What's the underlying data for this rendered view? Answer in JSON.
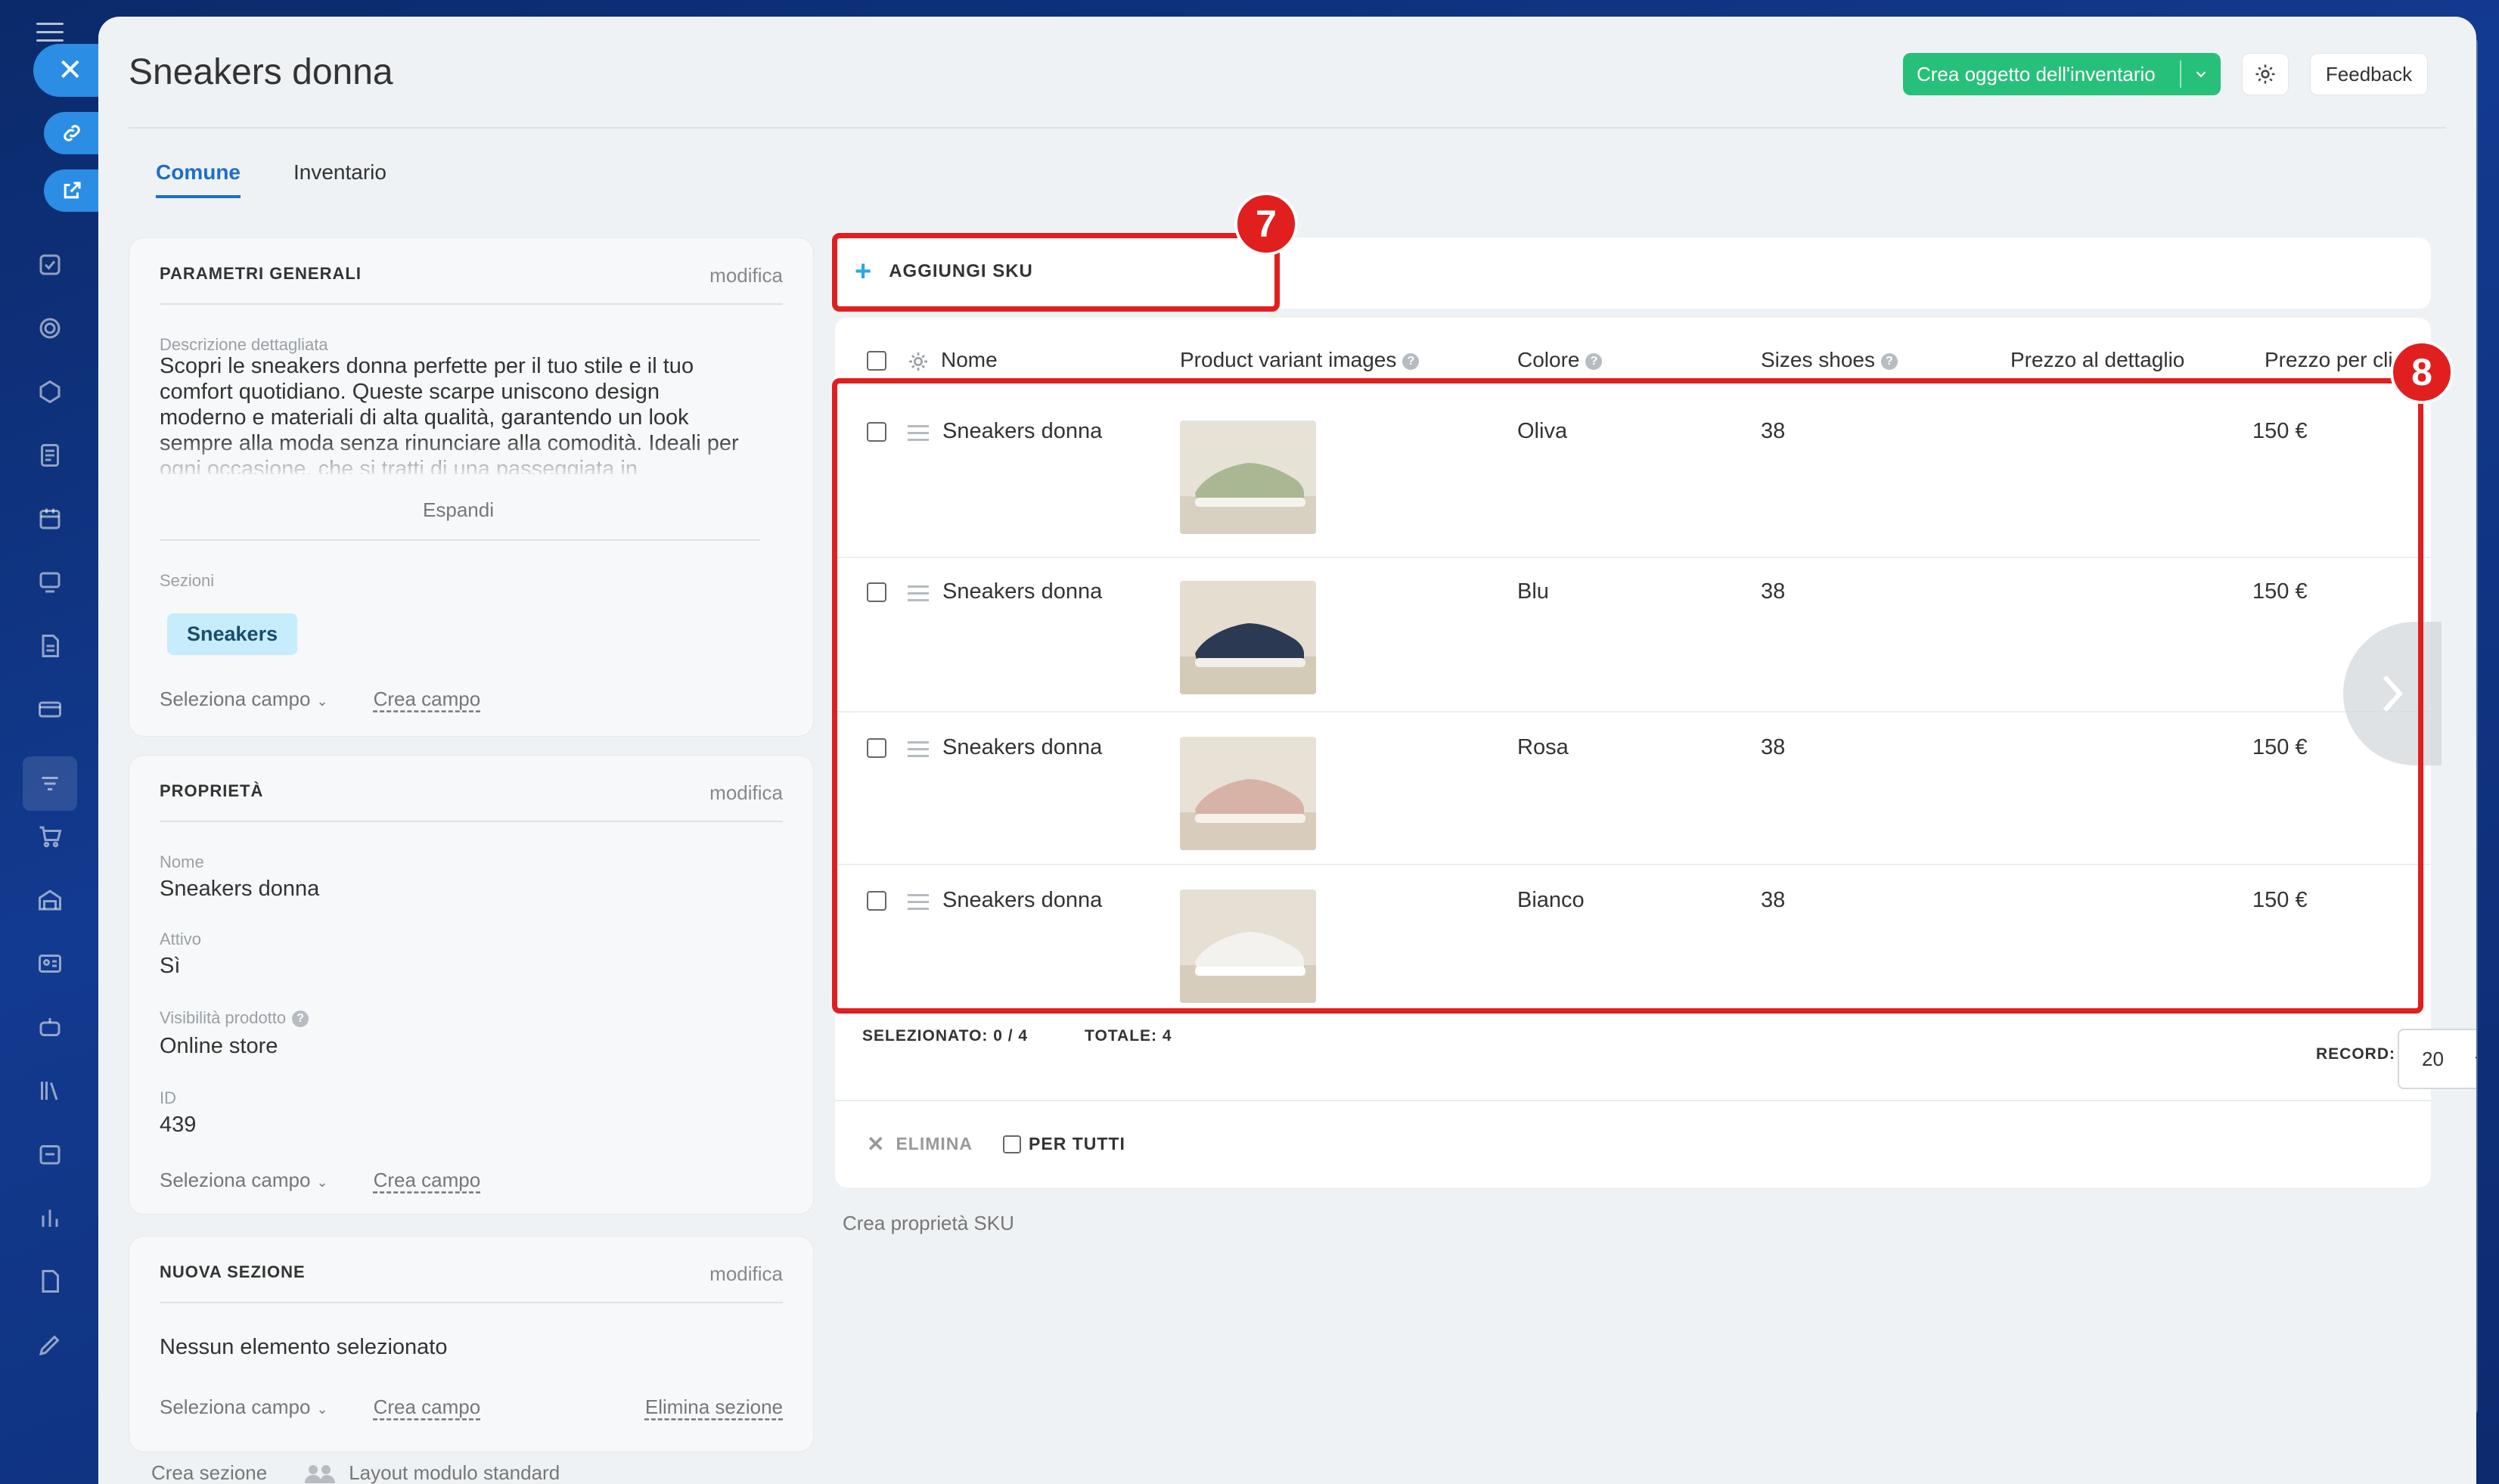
{
  "page": {
    "title": "Sneakers donna",
    "tabs": [
      "Comune",
      "Inventario"
    ],
    "create_button": "Crea oggetto dell'inventario",
    "feedback_button": "Feedback"
  },
  "general": {
    "header": "PARAMETRI GENERALI",
    "edit": "modifica",
    "desc_label": "Descrizione dettagliata",
    "description": "Scopri le sneakers donna perfette per il tuo stile e il tuo comfort quotidiano. Queste scarpe uniscono design moderno e materiali di alta qualità, garantendo un look sempre alla moda senza rinunciare alla comodità. Ideali per ogni occasione, che si tratti di una passeggiata in",
    "expand": "Espandi",
    "sections_label": "Sezioni",
    "section_tag": "Sneakers",
    "select_field": "Seleziona campo",
    "create_field": "Crea campo"
  },
  "properties": {
    "header": "PROPRIETÀ",
    "edit": "modifica",
    "name_label": "Nome",
    "name_value": "Sneakers donna",
    "active_label": "Attivo",
    "active_value": "Sì",
    "visibility_label": "Visibilità prodotto",
    "visibility_value": "Online store",
    "id_label": "ID",
    "id_value": "439",
    "select_field": "Seleziona campo",
    "create_field": "Crea campo"
  },
  "new_section": {
    "header": "NUOVA SEZIONE",
    "edit": "modifica",
    "empty": "Nessun elemento selezionato",
    "select_field": "Seleziona campo",
    "create_field": "Crea campo",
    "delete_section": "Elimina sezione"
  },
  "bottom": {
    "create_section": "Crea sezione",
    "layout": "Layout modulo standard"
  },
  "sku": {
    "add": "AGGIUNGI SKU",
    "columns": [
      "Nome",
      "Product variant images",
      "Colore",
      "Sizes shoes",
      "Prezzo al dettaglio",
      "Prezzo per clienti"
    ],
    "rows": [
      {
        "name": "Sneakers donna",
        "color": "Oliva",
        "size": "38",
        "price": "150 €"
      },
      {
        "name": "Sneakers donna",
        "color": "Blu",
        "size": "38",
        "price": "150 €"
      },
      {
        "name": "Sneakers donna",
        "color": "Rosa",
        "size": "38",
        "price": "150 €"
      },
      {
        "name": "Sneakers donna",
        "color": "Bianco",
        "size": "38",
        "price": "150 €"
      }
    ],
    "selected_label": "SELEZIONATO:",
    "selected_value": "0 / 4",
    "total_label": "TOTALE:",
    "total_value": "4",
    "record_label": "RECORD:",
    "record_value": "20",
    "delete": "ELIMINA",
    "for_all": "PER TUTTI",
    "create_sku_prop": "Crea proprietà SKU"
  },
  "annotations": [
    "7",
    "8"
  ],
  "colors": {
    "accent": "#27c07a",
    "annotation": "#e11f1f",
    "tab_active": "#1e6ec8"
  }
}
